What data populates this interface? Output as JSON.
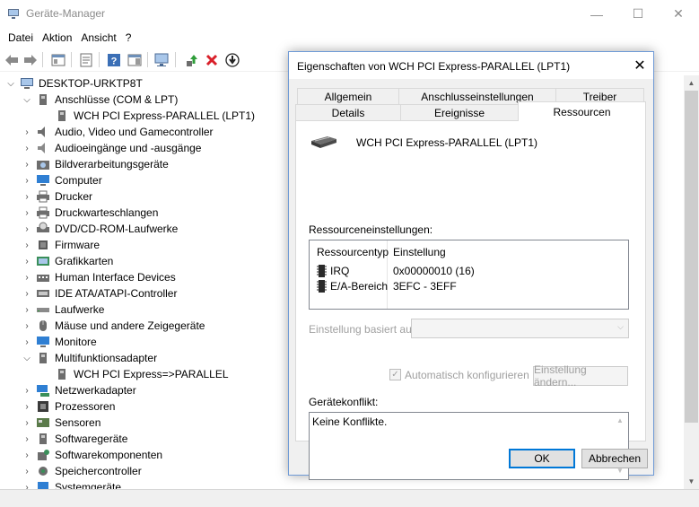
{
  "window": {
    "title": "Geräte-Manager",
    "controls": {
      "minimize": "—",
      "maximize": "☐",
      "close": "✕"
    }
  },
  "menu": [
    "Datei",
    "Aktion",
    "Ansicht",
    "?"
  ],
  "toolbar": {
    "icons": [
      "back-arrow-icon",
      "forward-arrow-icon",
      "console-tree-icon",
      "properties-icon",
      "help-icon",
      "action-pane-icon",
      "scan-hardware-icon",
      "update-driver-icon",
      "uninstall-icon",
      "disable-device-icon"
    ]
  },
  "tree": {
    "root": "DESKTOP-URKTP8T",
    "items": [
      {
        "label": "Anschlüsse (COM & LPT)",
        "expanded": true
      },
      {
        "label": "WCH PCI Express-PARALLEL (LPT1)",
        "child": true
      },
      {
        "label": "Audio, Video und Gamecontroller"
      },
      {
        "label": "Audioeingänge und -ausgänge"
      },
      {
        "label": "Bildverarbeitungsgeräte"
      },
      {
        "label": "Computer"
      },
      {
        "label": "Drucker"
      },
      {
        "label": "Druckwarteschlangen"
      },
      {
        "label": "DVD/CD-ROM-Laufwerke"
      },
      {
        "label": "Firmware"
      },
      {
        "label": "Grafikkarten"
      },
      {
        "label": "Human Interface Devices"
      },
      {
        "label": "IDE ATA/ATAPI-Controller"
      },
      {
        "label": "Laufwerke"
      },
      {
        "label": "Mäuse und andere Zeigegeräte"
      },
      {
        "label": "Monitore"
      },
      {
        "label": "Multifunktionsadapter",
        "expanded": true
      },
      {
        "label": "WCH PCI Express=>PARALLEL",
        "child": true
      },
      {
        "label": "Netzwerkadapter"
      },
      {
        "label": "Prozessoren"
      },
      {
        "label": "Sensoren"
      },
      {
        "label": "Softwaregeräte"
      },
      {
        "label": "Softwarekomponenten"
      },
      {
        "label": "Speichercontroller"
      },
      {
        "label": "Systemgeräte"
      }
    ]
  },
  "dialog": {
    "title": "Eigenschaften von WCH PCI Express-PARALLEL (LPT1)",
    "close": "✕",
    "tabs_back": [
      "Allgemein",
      "Anschlusseinstellungen",
      "Treiber"
    ],
    "tabs_front": [
      "Details",
      "Ereignisse",
      "Ressourcen"
    ],
    "active_tab": "Ressourcen",
    "device_name": "WCH PCI Express-PARALLEL (LPT1)",
    "resources_label": "Ressourceneinstellungen:",
    "resources_headers": [
      "Ressourcentyp",
      "Einstellung"
    ],
    "resources_rows": [
      {
        "type": "IRQ",
        "value": "0x00000010 (16)"
      },
      {
        "type": "E/A-Bereich",
        "value": "3EFC - 3EFF"
      }
    ],
    "based_on_label": "Einstellung basiert auf:",
    "based_on_value": "",
    "auto_config_label": "Automatisch konfigurieren",
    "auto_config_checked": true,
    "change_setting_button": "Einstellung ändern...",
    "conflict_label": "Gerätekonflikt:",
    "conflict_text": "Keine Konflikte.",
    "ok_button": "OK",
    "cancel_button": "Abbrechen"
  },
  "colors": {
    "accent": "#0078d7",
    "dialog_border": "#6f9ad6",
    "disabled_text": "#a0a0a0"
  }
}
